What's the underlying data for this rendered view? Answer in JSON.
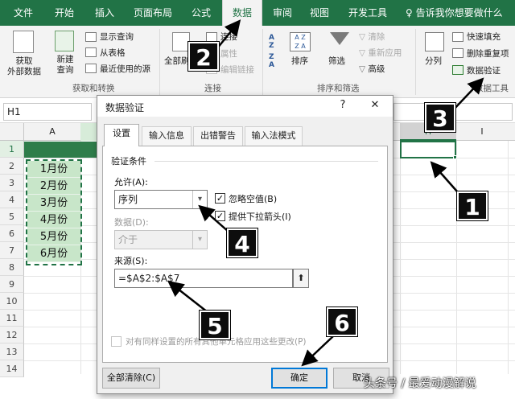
{
  "ribbon_tabs": [
    "文件",
    "开始",
    "插入",
    "页面布局",
    "公式",
    "数据",
    "审阅",
    "视图",
    "开发工具"
  ],
  "active_tab": "数据",
  "tellme": "告诉我你想要做什么",
  "ribbon": {
    "get_external": "获取\n外部数据",
    "new_query": "新建\n查询",
    "show_queries": "显示查询",
    "from_table": "从表格",
    "recent_sources": "最近使用的源",
    "group_get_transform": "获取和转换",
    "refresh_all": "全部刷新",
    "connections": "连接",
    "properties": "属性",
    "edit_links": "编辑链接",
    "group_connections": "连接",
    "sort": "排序",
    "filter": "筛选",
    "clear": "清除",
    "reapply": "重新应用",
    "advanced": "高级",
    "group_sort_filter": "排序和筛选",
    "split": "分列",
    "flash_fill": "快速填充",
    "remove_dup": "删除重复项",
    "data_validation": "数据验证",
    "group_data_tools": "数据工具",
    "sort_az": "A\nZ",
    "sort_za": "Z\nA"
  },
  "formula_bar": {
    "name_box": "H1"
  },
  "sheet": {
    "col_a": "A",
    "col_h": "H",
    "col_i": "I",
    "rows": [
      "1",
      "2",
      "3",
      "4",
      "5",
      "6",
      "7",
      "8",
      "9",
      "10",
      "11",
      "12",
      "13",
      "14"
    ],
    "months": [
      "1月份",
      "2月份",
      "3月份",
      "4月份",
      "5月份",
      "6月份"
    ]
  },
  "dialog": {
    "title": "数据验证",
    "help": "?",
    "close": "✕",
    "tabs": [
      "设置",
      "输入信息",
      "出错警告",
      "输入法模式"
    ],
    "criteria_label": "验证条件",
    "allow_label": "允许(A):",
    "allow_value": "序列",
    "ignore_blank": "忽略空值(B)",
    "in_cell_dropdown": "提供下拉箭头(I)",
    "data_label": "数据(D):",
    "data_value": "介于",
    "source_label": "来源(S):",
    "source_value": "=$A$2:$A$7",
    "apply_all": "对有同样设置的所有其他单元格应用这些更改(P)",
    "clear_all": "全部清除(C)",
    "ok": "确定",
    "cancel": "取消"
  },
  "badges": [
    "1",
    "2",
    "3",
    "4",
    "5",
    "6"
  ],
  "watermark": "头条号 / 最爱动漫解说",
  "colors": {
    "excel_green": "#217346",
    "selection_green": "#c8e6c9"
  }
}
